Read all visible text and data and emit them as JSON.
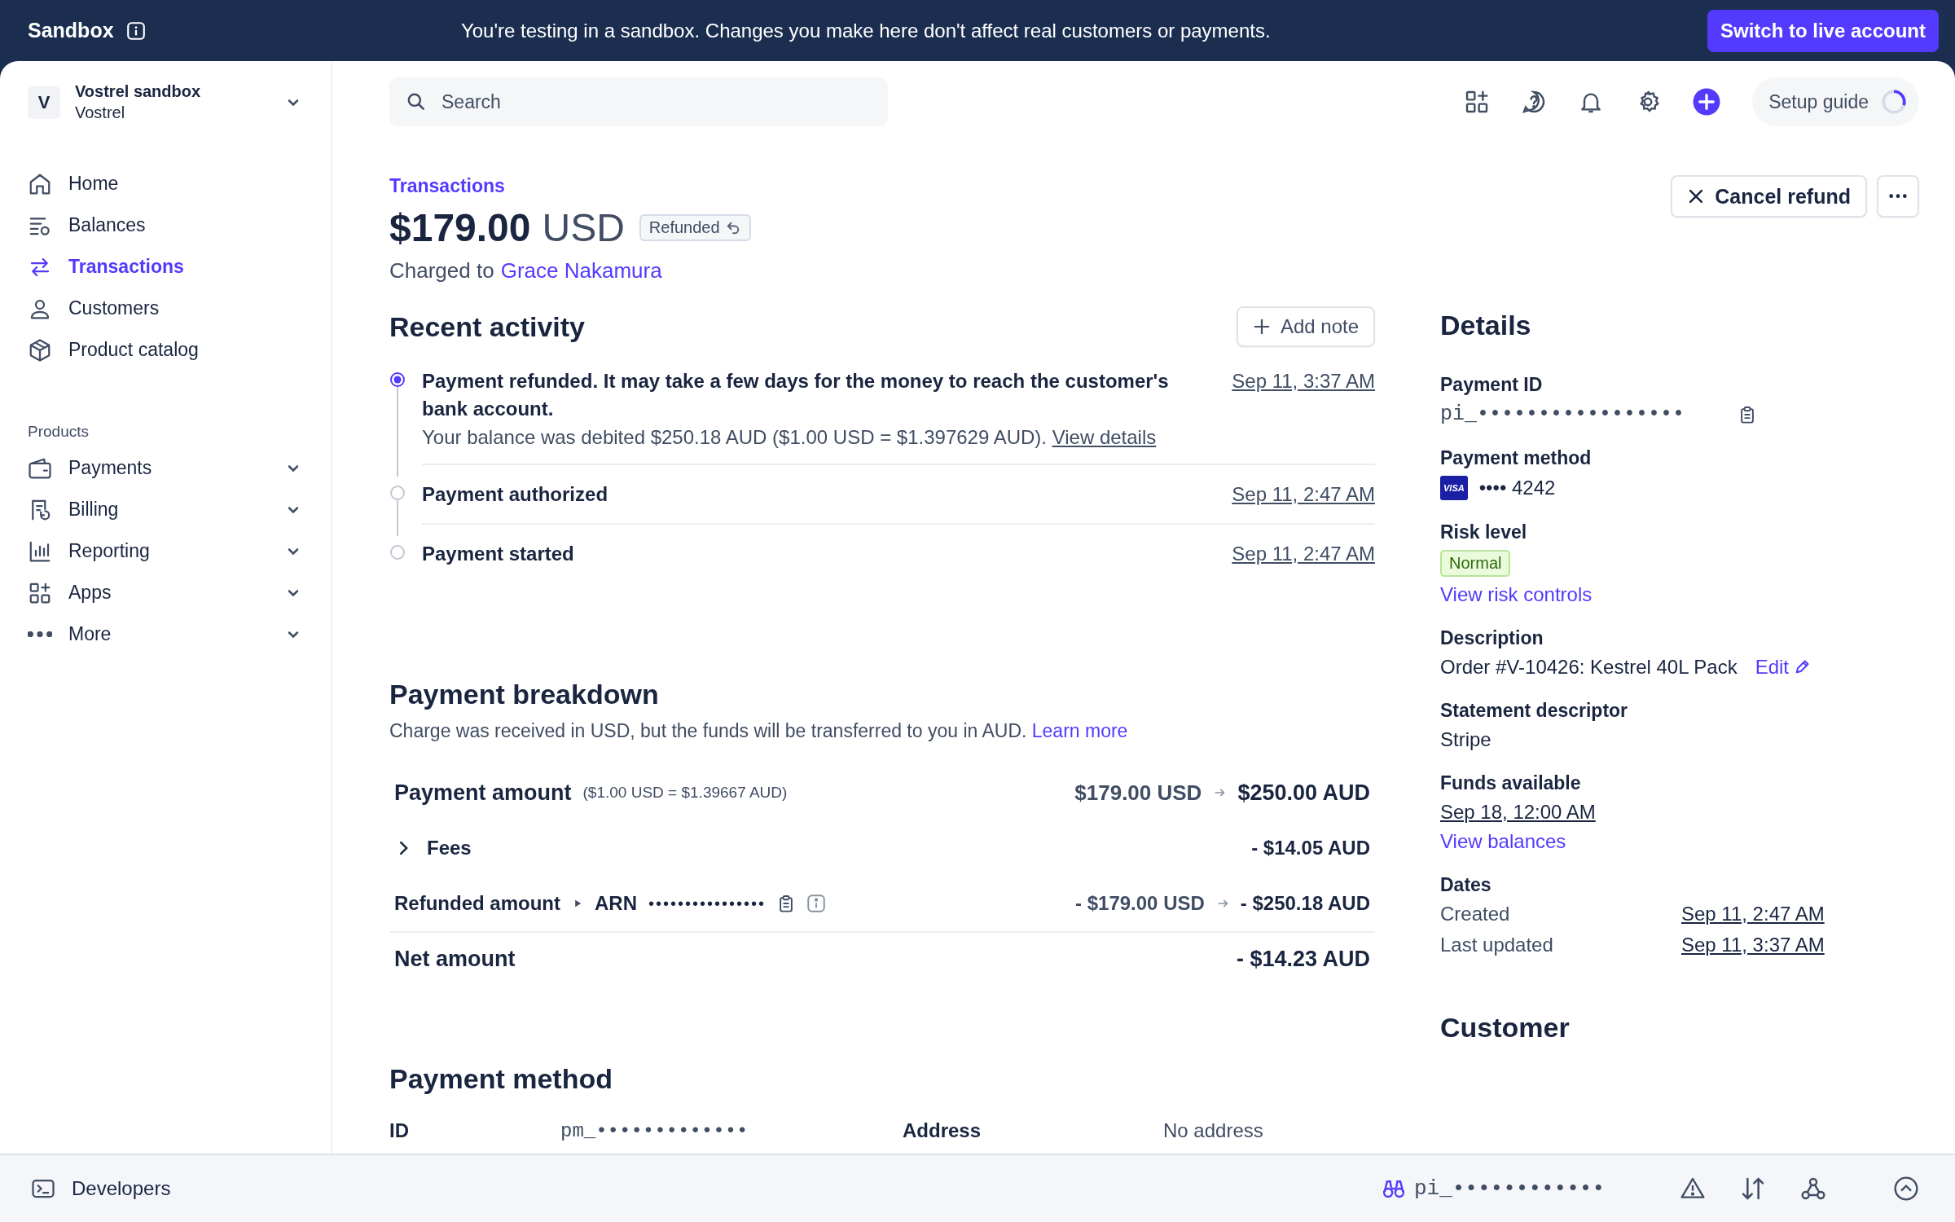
{
  "banner": {
    "label": "Sandbox",
    "message": "You're testing in a sandbox. Changes you make here don't affect real customers or payments.",
    "switch_button": "Switch to live account"
  },
  "account": {
    "initial": "V",
    "name": "Vostrel sandbox",
    "org": "Vostrel"
  },
  "nav": [
    {
      "label": "Home",
      "selected": false
    },
    {
      "label": "Balances",
      "selected": false
    },
    {
      "label": "Transactions",
      "selected": true
    },
    {
      "label": "Customers",
      "selected": false
    },
    {
      "label": "Product catalog",
      "selected": false
    }
  ],
  "products_heading": "Products",
  "product_nav": [
    {
      "label": "Payments"
    },
    {
      "label": "Billing"
    },
    {
      "label": "Reporting"
    },
    {
      "label": "Apps"
    },
    {
      "label": "More"
    }
  ],
  "topbar": {
    "search_placeholder": "Search",
    "setup_guide": {
      "label": "Setup guide",
      "level": 0.3
    }
  },
  "header": {
    "breadcrumb": "Transactions",
    "amount": "$179.00",
    "currency": "USD",
    "status": "Refunded",
    "charged_prefix": "Charged to",
    "customer": "Grace Nakamura",
    "cancel_button": "Cancel refund"
  },
  "recent_activity": {
    "title": "Recent activity",
    "add_note": "Add note",
    "events": [
      {
        "title": "Payment refunded. It may take a few days for the money to reach the customer's bank account.",
        "detail": "Your balance was debited $250.18 AUD ($1.00 USD = $1.397629 AUD).",
        "link": "View details",
        "time": "Sep 11, 3:37 AM",
        "current": true
      },
      {
        "title": "Payment authorized",
        "time": "Sep 11, 2:47 AM",
        "current": false
      },
      {
        "title": "Payment started",
        "time": "Sep 11, 2:47 AM",
        "current": false
      }
    ]
  },
  "breakdown": {
    "title": "Payment breakdown",
    "note": "Charge was received in USD, but the funds will be transferred to you in AUD.",
    "learn_more": "Learn more",
    "rows": [
      {
        "kind": "conversion",
        "label": "Payment amount",
        "rate": "($1.00 USD = $1.39667 AUD)",
        "from": "$179.00 USD",
        "to": "$250.00 AUD"
      },
      {
        "kind": "expandable",
        "label": "Fees",
        "to": "- $14.05 AUD"
      },
      {
        "kind": "refund",
        "label": "Refunded amount",
        "arn_label": "ARN",
        "arn": "••••••••••••••••",
        "from": "- $179.00 USD",
        "to": "- $250.18 AUD"
      },
      {
        "kind": "total",
        "label": "Net amount",
        "to": "- $14.23 AUD"
      }
    ]
  },
  "payment_method": {
    "title": "Payment method",
    "fields": [
      {
        "label": "ID",
        "value": "pm_•••••••••••••"
      },
      {
        "label": "Address",
        "value": "No address"
      }
    ]
  },
  "details": {
    "title": "Details",
    "payment_id_label": "Payment ID",
    "payment_id": "pi_•••••••••••••••••",
    "method_label": "Payment method",
    "card_brand": "VISA",
    "card_number": "•••• 4242",
    "risk_label": "Risk level",
    "risk": "Normal",
    "risk_link": "View risk controls",
    "description_label": "Description",
    "description": "Order #V-10426: Kestrel 40L Pack",
    "edit": "Edit",
    "statement_label": "Statement descriptor",
    "statement": "Stripe",
    "funds_label": "Funds available",
    "funds_date": "Sep 18, 12:00 AM",
    "funds_link": "View balances",
    "dates_label": "Dates",
    "dates": [
      {
        "label": "Created",
        "value": "Sep 11, 2:47 AM"
      },
      {
        "label": "Last updated",
        "value": "Sep 11, 3:37 AM"
      }
    ],
    "customer_title": "Customer"
  },
  "footer": {
    "developers": "Developers",
    "object_id": "pi_••••••••••••"
  }
}
